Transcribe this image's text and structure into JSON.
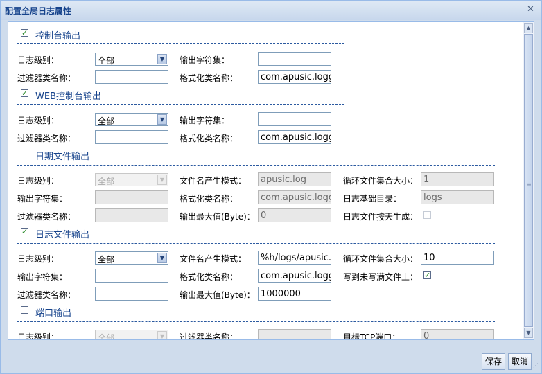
{
  "dialog": {
    "title": "配置全局日志属性",
    "save": "保存",
    "cancel": "取消"
  },
  "icons": {
    "close": "close-icon",
    "dropdown": "chevron-down-icon"
  },
  "console": {
    "title": "控制台输出",
    "checked": true,
    "log_level_label": "日志级别：",
    "log_level": "全部",
    "charset_label": "输出字符集：",
    "charset": "",
    "filter_label": "过滤器类名称：",
    "filter": "",
    "formatter_label": "格式化类名称：",
    "formatter": "com.apusic.logg"
  },
  "web": {
    "title": "WEB控制台输出",
    "checked": true,
    "log_level_label": "日志级别：",
    "log_level": "全部",
    "charset_label": "输出字符集：",
    "charset": "",
    "filter_label": "过滤器类名称：",
    "filter": "",
    "formatter_label": "格式化类名称：",
    "formatter": "com.apusic.logg"
  },
  "datefile": {
    "title": "日期文件输出",
    "checked": false,
    "log_level_label": "日志级别：",
    "log_level": "全部",
    "pattern_label": "文件名产生模式：",
    "pattern": "apusic.log",
    "rotate_label": "循环文件集合大小：",
    "rotate": "1",
    "charset_label": "输出字符集：",
    "charset": "",
    "formatter_label": "格式化类名称：",
    "formatter": "com.apusic.logg",
    "basedir_label": "日志基础目录：",
    "basedir": "logs",
    "filter_label": "过滤器类名称：",
    "filter": "",
    "maxsize_label": "输出最大值(Byte)：",
    "maxsize": "0",
    "daily_label": "日志文件按天生成：",
    "daily": false
  },
  "logfile": {
    "title": "日志文件输出",
    "checked": true,
    "log_level_label": "日志级别：",
    "log_level": "全部",
    "pattern_label": "文件名产生模式：",
    "pattern": "%h/logs/apusic.",
    "rotate_label": "循环文件集合大小：",
    "rotate": "10",
    "charset_label": "输出字符集：",
    "charset": "",
    "formatter_label": "格式化类名称：",
    "formatter": "com.apusic.logg",
    "append_label": "写到未写满文件上：",
    "append": true,
    "filter_label": "过滤器类名称：",
    "filter": "",
    "maxsize_label": "输出最大值(Byte)：",
    "maxsize": "1000000"
  },
  "port": {
    "title": "端口输出",
    "checked": false,
    "log_level_label": "日志级别：",
    "log_level": "全部",
    "filter_label": "过滤器类名称：",
    "filter": "",
    "tcp_label": "目标TCP端口：",
    "tcp": "0"
  }
}
